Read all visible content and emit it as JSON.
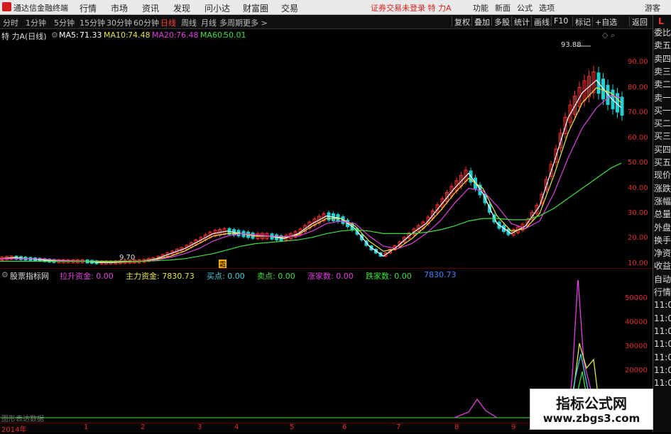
{
  "app": {
    "title": "通达信金融终端"
  },
  "menu": [
    "行情",
    "市场",
    "资讯",
    "发现",
    "问小达",
    "财富圈",
    "交易"
  ],
  "notice": "证券交易未登录  特 力A",
  "menu_right": [
    "功能",
    "新面",
    "公式",
    "选项",
    "游客"
  ],
  "periods": [
    "分时",
    "1分钟",
    "5分钟",
    "15分钟",
    "30分钟",
    "60分钟",
    "日线",
    "周线",
    "月线",
    "多周期",
    "更多 >"
  ],
  "active_period": "日线",
  "tools": [
    "复权",
    "叠加",
    "多股",
    "统计",
    "画线",
    "F10",
    "标记",
    "+自选",
    "返回"
  ],
  "right_panel": {
    "badge": "L",
    "items": [
      "委比",
      "卖五",
      "卖四",
      "卖三",
      "卖二",
      "卖一",
      "买一",
      "买二",
      "买三",
      "买四",
      "买五",
      "现价",
      "涨跌",
      "涨幅",
      "总量",
      "外盘",
      "换手",
      "净资",
      "收益",
      "自动",
      "行情",
      "11:0",
      "11:0",
      "11:0",
      "11:0",
      "11:0",
      "11:0",
      "11:0"
    ]
  },
  "chart_title": {
    "stock": "特 力A",
    "period": "(日线)",
    "ma5_label": "MA5:",
    "ma5": "71.33",
    "ma10_label": "MA10:",
    "ma10": "74.48",
    "ma20_label": "MA20:",
    "ma20": "76.48",
    "ma60_label": "MA60:",
    "ma60": "50.01"
  },
  "annotations": {
    "high": "93.88",
    "low": "9.70",
    "marker": "霜"
  },
  "price_axis": [
    "90.00",
    "80.00",
    "70.00",
    "60.00",
    "50.00",
    "40.00",
    "30.00",
    "20.00",
    "10.00"
  ],
  "indicator": {
    "name": "股票指标网",
    "items": [
      {
        "label": "拉升资金:",
        "value": "0.00",
        "color": "#e040e0"
      },
      {
        "label": "主力资金:",
        "value": "7830.73",
        "color": "#e6e640"
      },
      {
        "label": "买点:",
        "value": "0.00",
        "color": "#40d0e0"
      },
      {
        "label": "卖点:",
        "value": "0.00",
        "color": "#40e040"
      },
      {
        "label": "涨家数:",
        "value": "0.00",
        "color": "#e040e0"
      },
      {
        "label": "跌家数:",
        "value": "0.00",
        "color": "#40e040"
      },
      {
        "label": "",
        "value": "7830.73",
        "color": "#4080ff"
      }
    ]
  },
  "ind_axis": [
    "50000",
    "40000",
    "30000",
    "20000"
  ],
  "bottom_note": "图形表达数据",
  "time_axis": [
    "2014年",
    "1",
    "2",
    "3",
    "4",
    "5",
    "6",
    "7",
    "8",
    "9"
  ],
  "watermark": {
    "line1": "指标公式网",
    "line2": "www.zbgs3.com"
  },
  "colors": {
    "up": "#ff3030",
    "down": "#20d0d0",
    "ma5": "#ffffff",
    "ma10": "#e6e640",
    "ma20": "#e040e0",
    "ma60": "#40e040",
    "axis": "#e03030"
  },
  "chart_data": {
    "type": "line",
    "x": [
      0,
      20,
      40,
      60,
      80,
      100,
      120,
      140,
      160,
      180,
      200,
      220,
      240,
      260,
      280,
      300,
      320,
      340,
      360,
      380,
      400,
      420,
      440,
      460,
      480,
      500,
      520,
      540,
      560,
      580,
      600,
      620,
      640,
      660,
      680,
      700,
      720,
      740,
      760,
      780,
      800,
      820,
      840,
      860,
      875
    ],
    "series": [
      {
        "name": "MA5",
        "values": [
          12,
          12.5,
          12,
          11.5,
          11,
          11,
          11,
          10.5,
          10.5,
          10.8,
          11,
          12,
          14,
          16,
          19,
          22,
          23,
          22,
          21,
          21,
          20,
          22,
          26,
          29,
          28,
          24,
          17,
          13,
          17,
          22,
          26,
          33,
          40,
          46,
          38,
          26,
          22,
          25,
          33,
          50,
          68,
          78,
          83,
          76,
          72
        ]
      },
      {
        "name": "MA10",
        "values": [
          12,
          12.3,
          12,
          11.8,
          11.2,
          11,
          11,
          10.8,
          10.7,
          10.8,
          11,
          11.8,
          13,
          15,
          18,
          21,
          22,
          22,
          21,
          21,
          20.5,
          21.5,
          25,
          28,
          28,
          25,
          19,
          15,
          16,
          20,
          25,
          31,
          38,
          44,
          40,
          29,
          23,
          24,
          30,
          45,
          62,
          74,
          80,
          78,
          74
        ]
      },
      {
        "name": "MA20",
        "values": [
          12,
          12.1,
          12,
          11.9,
          11.5,
          11.2,
          11,
          11,
          10.9,
          10.9,
          11,
          11.5,
          12.5,
          14,
          16,
          19,
          21,
          22,
          21.5,
          21,
          20.8,
          21,
          23,
          26,
          27,
          26,
          21,
          17,
          16,
          18,
          22,
          27,
          34,
          40,
          39,
          33,
          26,
          24,
          27,
          38,
          52,
          64,
          72,
          77,
          76
        ]
      },
      {
        "name": "MA60",
        "values": [
          11,
          11,
          11,
          11,
          11,
          11,
          11,
          11,
          11,
          11,
          11,
          11.2,
          11.5,
          12,
          13,
          14,
          15.5,
          17,
          18,
          18.5,
          19,
          19.5,
          20.5,
          22,
          23,
          23.5,
          23,
          22,
          22,
          22,
          22.5,
          23.5,
          25,
          27,
          28,
          28,
          27.5,
          27.5,
          29,
          32,
          36,
          40,
          44,
          48,
          50
        ]
      }
    ],
    "ylim": [
      8,
      96
    ]
  }
}
